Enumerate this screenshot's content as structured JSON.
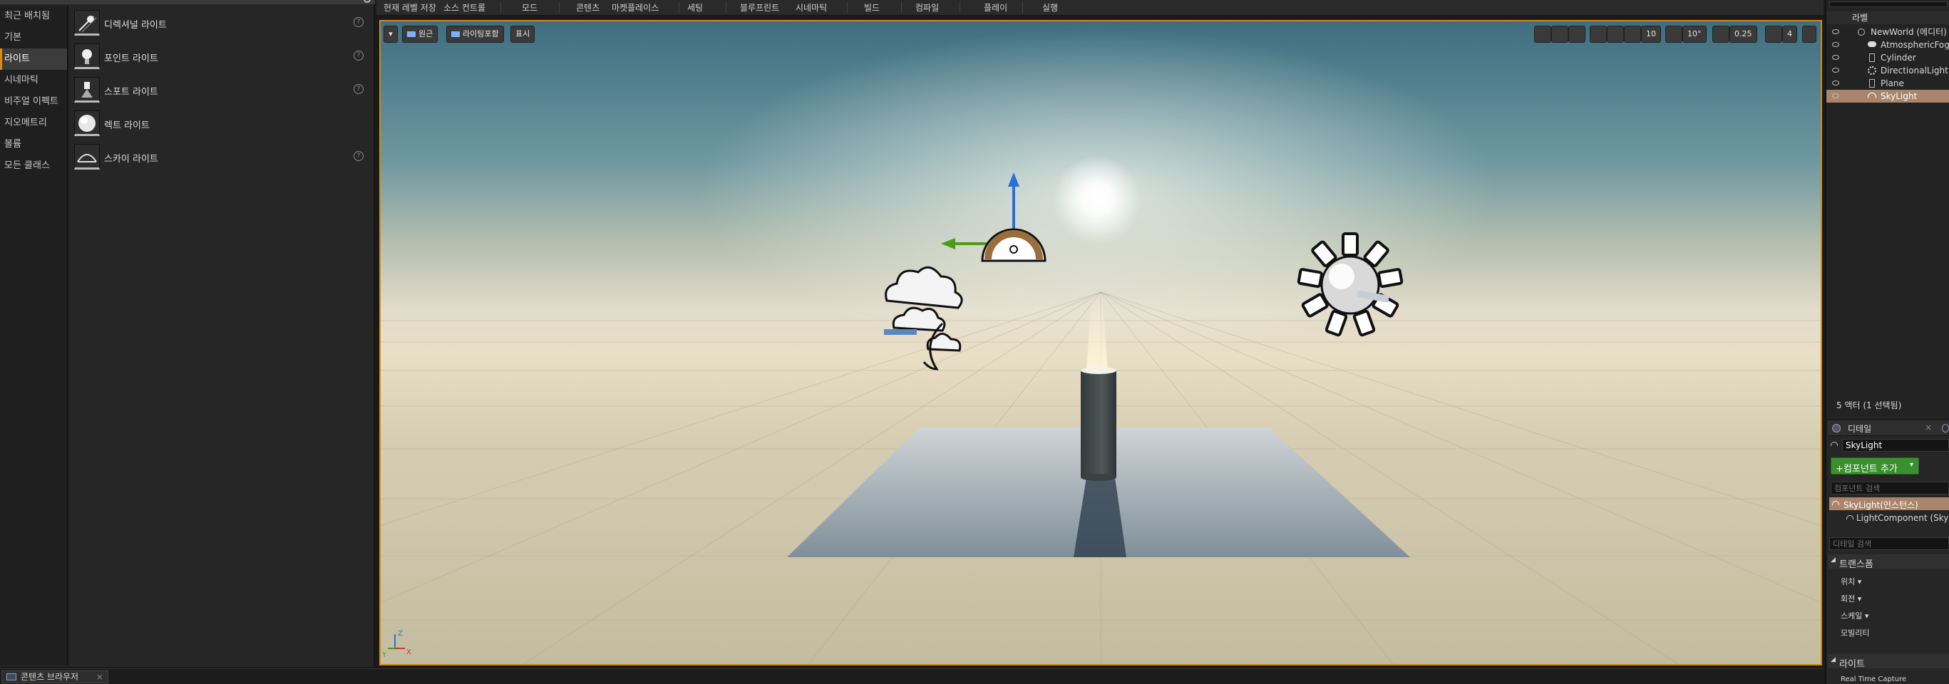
{
  "place_panel": {
    "categories": [
      "최근 배치됨",
      "기본",
      "라이트",
      "시네마틱",
      "비주얼 이펙트",
      "지오메트리",
      "볼륨",
      "모든 클래스"
    ],
    "active_category": "라이트",
    "items": [
      {
        "label": "디렉셔널 라이트",
        "icon": "directional-light-icon"
      },
      {
        "label": "포인트 라이트",
        "icon": "point-light-icon"
      },
      {
        "label": "스포트 라이트",
        "icon": "spot-light-icon"
      },
      {
        "label": "렉트 라이트",
        "icon": "rect-light-icon"
      },
      {
        "label": "스카이 라이트",
        "icon": "sky-light-icon"
      }
    ],
    "help_glyph": "?"
  },
  "toolbar": {
    "items": [
      "현재 레벨 저장",
      "소스 컨트롤",
      "모드",
      "콘텐츠",
      "마켓플레이스",
      "세팅",
      "블루프린트",
      "시네마틱",
      "빌드",
      "컴파일",
      "플레이",
      "실행"
    ]
  },
  "viewport": {
    "left_controls": {
      "menu_glyph": "▾",
      "perspective": "원근",
      "lit": "라이팅포함",
      "show": "표시"
    },
    "right_controls": {
      "grid_snap": "10",
      "rotate_snap": "10°",
      "scale_snap": "0.25",
      "camera_speed": "4"
    },
    "axis": {
      "x": "X",
      "y": "Y",
      "z": "Z"
    },
    "colors": {
      "selection_border": "#d08a18",
      "gizmo_z": "#2a6fd6",
      "gizmo_y": "#4c9a1a",
      "gizmo_x": "#c83a2a"
    }
  },
  "outliner": {
    "header": "라벨",
    "rows": [
      {
        "label": "NewWorld (에디터)",
        "indent": 0,
        "icon": "world-icon"
      },
      {
        "label": "AtmosphericFog",
        "indent": 1,
        "icon": "fog-icon"
      },
      {
        "label": "Cylinder",
        "indent": 1,
        "icon": "mesh-icon"
      },
      {
        "label": "DirectionalLight",
        "indent": 1,
        "icon": "sun-icon"
      },
      {
        "label": "Plane",
        "indent": 1,
        "icon": "mesh-icon"
      },
      {
        "label": "SkyLight",
        "indent": 1,
        "icon": "sky-light-icon"
      }
    ],
    "selected": "SkyLight",
    "status": "5 액터 (1 선택됨)"
  },
  "details": {
    "tab_label": "디테일",
    "name_value": "SkyLight",
    "add_component_label": "+컴포넌트 추가",
    "component_search_placeholder": "컴포넌트 검색",
    "instance_row": "SkyLight(인스턴스)",
    "light_component_row": "LightComponent (SkyLig",
    "detail_search_placeholder": "디테일 검색",
    "transform_section": "트랜스폼",
    "transform_rows": [
      "위치",
      "회전",
      "스케일",
      "모빌리티"
    ],
    "light_section": "라이트",
    "realtime_capture": "Real Time Capture"
  },
  "bottom": {
    "content_browser_tab": "콘텐츠 브라우저"
  }
}
